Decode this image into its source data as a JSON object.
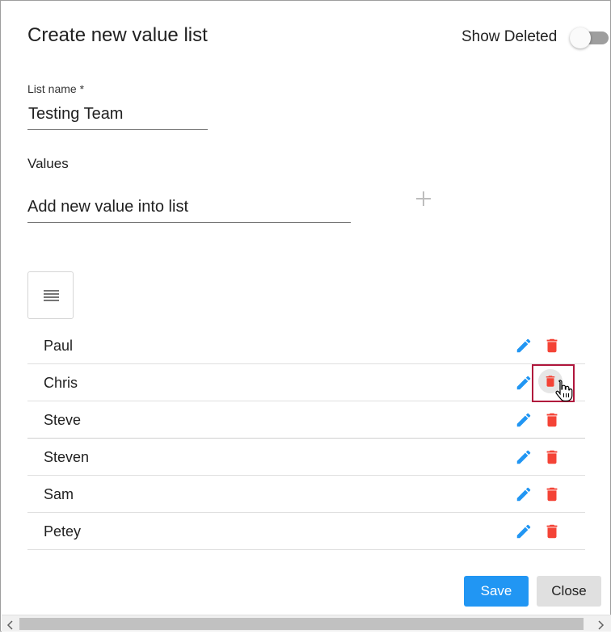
{
  "dialog": {
    "title": "Create new value list",
    "show_deleted_label": "Show Deleted",
    "show_deleted_on": false
  },
  "list_name": {
    "label": "List name *",
    "value": "Testing Team"
  },
  "values": {
    "label": "Values",
    "new_value_placeholder": "Add new value into list",
    "items": [
      {
        "label": "Paul"
      },
      {
        "label": "Chris"
      },
      {
        "label": "Steve"
      },
      {
        "label": "Steven"
      },
      {
        "label": "Sam"
      },
      {
        "label": "Petey"
      }
    ]
  },
  "actions": {
    "save_label": "Save",
    "close_label": "Close"
  },
  "icons": {
    "add": "plus-icon",
    "sort": "reorder-icon",
    "edit": "pencil-icon",
    "delete": "trash-icon",
    "cursor": "hand-pointer-icon"
  },
  "colors": {
    "primary": "#2196f3",
    "edit_icon": "#2196f3",
    "delete_icon": "#f44336",
    "highlight": "#b0163c",
    "close_button_bg": "#e0e0e0"
  }
}
